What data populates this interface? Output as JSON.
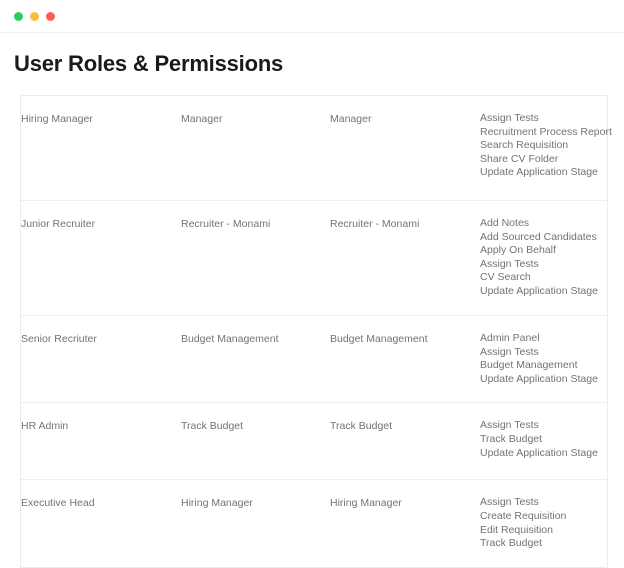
{
  "window": {
    "dots": [
      {
        "name": "close-dot",
        "color": "#2ecc5f"
      },
      {
        "name": "minimize-dot",
        "color": "#fdbc40"
      },
      {
        "name": "maximize-dot",
        "color": "#fc5f57"
      }
    ]
  },
  "page": {
    "title": "User Roles & Permissions"
  },
  "table": {
    "rows": [
      {
        "role": "Hiring Manager",
        "reports_to": "Manager",
        "manager": "Manager",
        "permissions": [
          "Assign Tests",
          "Recruitment Process Report",
          "Search Requisition",
          "Share CV Folder",
          "Update Application Stage"
        ]
      },
      {
        "role": "Junior Recruiter",
        "reports_to": "Recruiter - Monami",
        "manager": "Recruiter - Monami",
        "permissions": [
          "Add Notes",
          "Add Sourced Candidates",
          "Apply On Behalf",
          "Assign Tests",
          "CV Search",
          "Update Application Stage"
        ]
      },
      {
        "role": "Senior Recriuter",
        "reports_to": "Budget Management",
        "manager": "Budget Management",
        "permissions": [
          "Admin Panel",
          "Assign Tests",
          "Budget Management",
          "Update Application Stage"
        ]
      },
      {
        "role": "HR Admin",
        "reports_to": "Track Budget",
        "manager": "Track Budget",
        "permissions": [
          "Assign Tests",
          "Track Budget",
          "Update Application Stage"
        ]
      },
      {
        "role": "Executive Head",
        "reports_to": "Hiring Manager",
        "manager": "Hiring Manager",
        "permissions": [
          "Assign Tests",
          "Create Requisition",
          "Edit Requisition",
          "Track Budget"
        ]
      }
    ]
  }
}
